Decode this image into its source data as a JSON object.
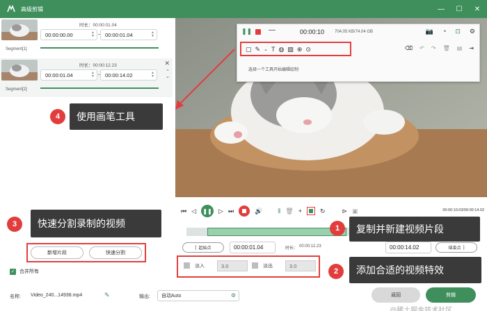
{
  "window": {
    "title": "高级剪辑"
  },
  "segments": [
    {
      "label": "Segment[1]",
      "duration": "时长：00:00:01.04",
      "start": "00:00:00.00",
      "end": "00:00:01.04"
    },
    {
      "label": "Segment[2]",
      "duration": "时长：00:00:12.23",
      "start": "00:00:01.04",
      "end": "00:00:14.02"
    }
  ],
  "callouts": {
    "c4": {
      "num": "4",
      "text": "使用画笔工具"
    },
    "c3": {
      "num": "3",
      "text": "快速分割录制的视频"
    },
    "c1": {
      "num": "1",
      "text": "复制并新建视频片段"
    },
    "c2": {
      "num": "2",
      "text": "添加合适的视频特效"
    }
  },
  "left_buttons": {
    "new_segment": "新增片段",
    "quick_split": "快速分割"
  },
  "merge_all": "合并所有",
  "toolbar": {
    "time": "00:00:10",
    "size": "704.05 KB/74.04 GB",
    "hint": "选择一个工具开始编辑绘制"
  },
  "player": {
    "time": "00:00:10.03/00:00:14.02"
  },
  "trim": {
    "start_btn": "起始点",
    "start": "00:00:01.04",
    "duration_label": "时长：",
    "duration": "00:00:12.23",
    "end": "00:00:14.02",
    "end_btn": "结束点"
  },
  "effects": {
    "fade_in_label": "淡入",
    "fade_in_value": "3.0",
    "fade_out_label": "淡出",
    "fade_out_value": "3.0"
  },
  "bottom": {
    "name_label": "名称:",
    "filename": "Video_240...14938.mp4",
    "output_label": "输出:",
    "output_value": "自动Auto",
    "back": "返回",
    "cut": "剪辑",
    "watermark": "@稀土掘金技术社区"
  },
  "colors": {
    "accent": "#3f8f5d",
    "callout_bg": "#3a3a3a",
    "badge": "#e23d3d"
  }
}
